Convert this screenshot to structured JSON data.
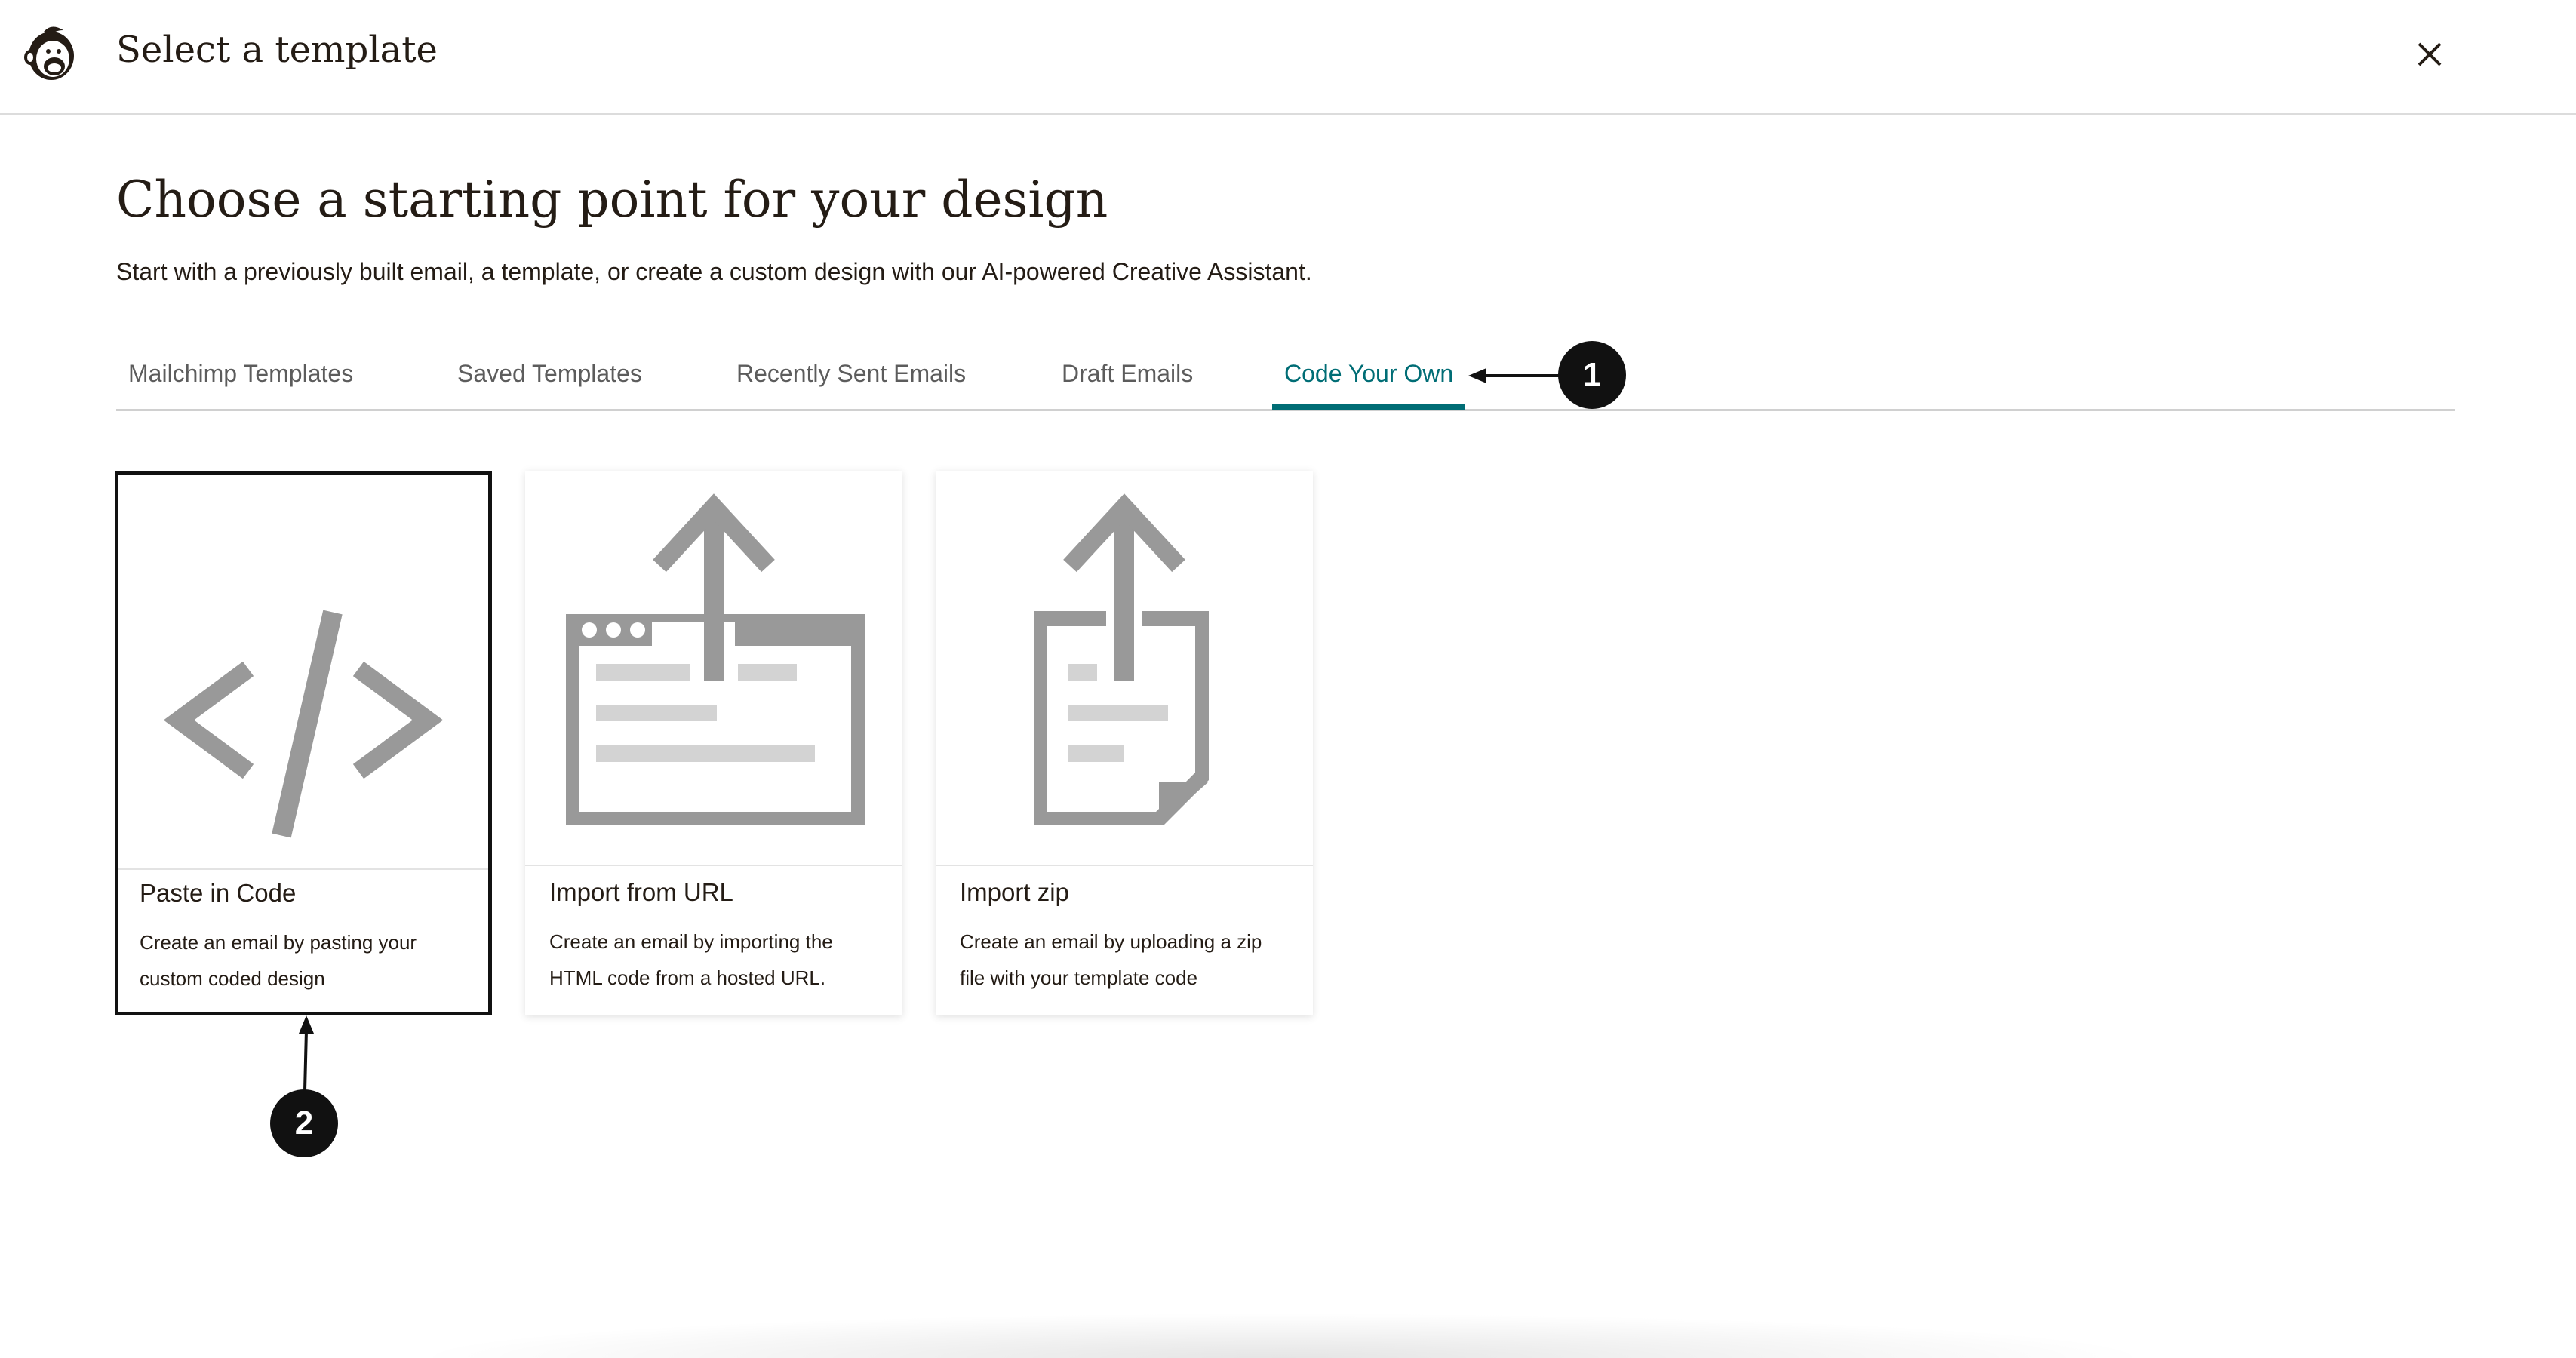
{
  "header": {
    "title": "Select a template",
    "logo_icon": "mailchimp-logo-icon",
    "close_icon": "close-icon"
  },
  "main": {
    "heading": "Choose a starting point for your design",
    "subtitle": "Start with a previously built email, a template, or create a custom design with our AI-powered Creative Assistant."
  },
  "tabs": [
    {
      "label": "Mailchimp Templates",
      "active": false
    },
    {
      "label": "Saved Templates",
      "active": false
    },
    {
      "label": "Recently Sent Emails",
      "active": false
    },
    {
      "label": "Draft Emails",
      "active": false
    },
    {
      "label": "Code Your Own",
      "active": true
    }
  ],
  "cards": [
    {
      "title": "Paste in Code",
      "description": "Create an email by pasting your custom coded design",
      "icon": "code-brackets-icon",
      "selected": true
    },
    {
      "title": "Import from URL",
      "description": "Create an email by importing the HTML code from a hosted URL.",
      "icon": "browser-upload-icon",
      "selected": false
    },
    {
      "title": "Import zip",
      "description": "Create an email by uploading a zip file with your template code",
      "icon": "file-upload-icon",
      "selected": false
    }
  ],
  "callouts": [
    {
      "number": "1"
    },
    {
      "number": "2"
    }
  ],
  "colors": {
    "accent": "#006d75",
    "text": "#241c15",
    "icon_gray": "#999999"
  }
}
